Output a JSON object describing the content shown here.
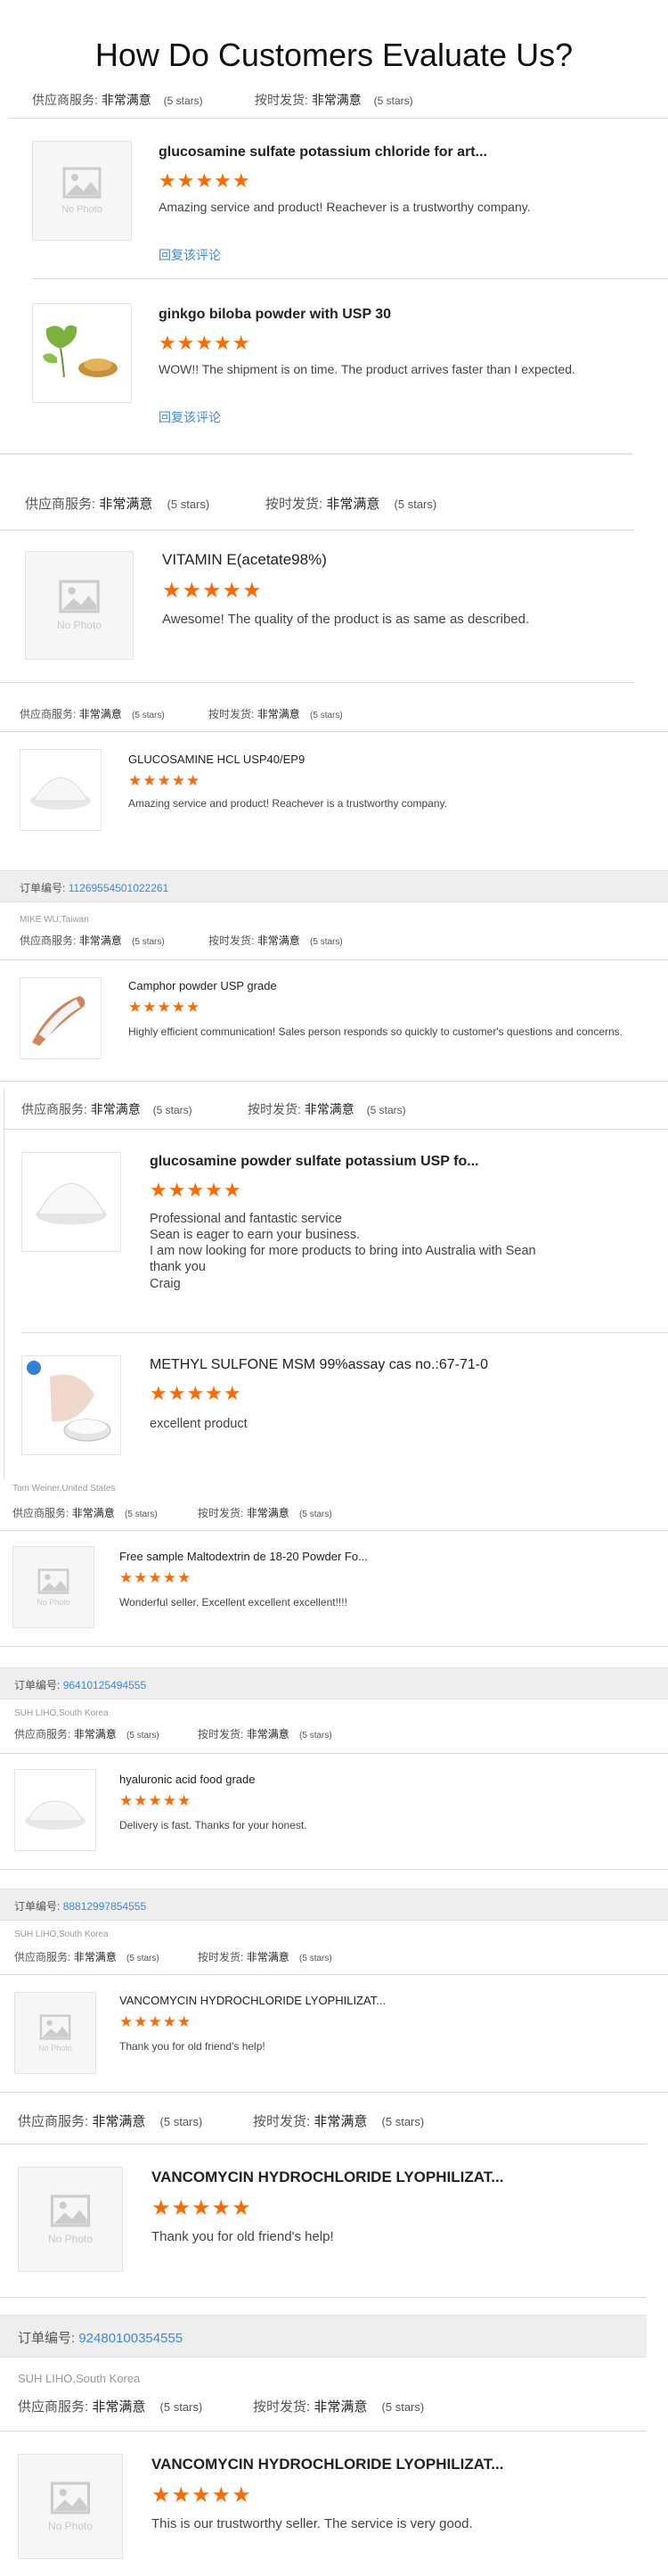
{
  "heading": "How Do Customers Evaluate Us?",
  "meta_labels": {
    "supplier": "供应商服务:",
    "ontime": "按时发货:",
    "value": "非常满意",
    "stars": "(5 stars)"
  },
  "no_photo": "No Photo",
  "reply_label": "回复该评论",
  "star_glyphs": "★★★★★",
  "order_label": "订单编号:",
  "block1": {
    "reviews": [
      {
        "title": "glucosamine sulfate potassium chloride for art...",
        "text": "Amazing service and product! Reachever is a trustworthy company."
      },
      {
        "title": "ginkgo biloba powder with USP 30",
        "text": "WOW!! The shipment is on time. The product arrives faster than I expected."
      }
    ]
  },
  "block2": {
    "title": "VITAMIN E(acetate98%)",
    "text": "Awesome! The quality of the product is as same as described."
  },
  "block3": {
    "title": "GLUCOSAMINE HCL USP40/EP9",
    "text": "Amazing service and product! Reachever is a trustworthy company."
  },
  "block4": {
    "order_no": "112695545010222​61",
    "user": "MIKE WU,Taiwan",
    "title": "Camphor powder USP grade",
    "text": "Highly efficient communication! Sales person responds so quickly to customer's questions and concerns."
  },
  "block5": {
    "reviews": [
      {
        "title": "glucosamine powder sulfate potassium USP fo...",
        "lines": [
          "Professional and fantastic service",
          "Sean is eager to earn your business.",
          "I am now looking for more products to bring into Australia with Sean",
          "thank you",
          "Craig"
        ]
      },
      {
        "title": "METHYL SULFONE MSM 99%assay cas no.:67-71-0",
        "lines": [
          "excellent product"
        ]
      }
    ]
  },
  "block6": {
    "user": "Tom Weiner,United States",
    "title": "Free sample Maltodextrin de 18-20 Powder Fo...",
    "text": "Wonderful seller. Excellent excellent excellent!!!!"
  },
  "block7": {
    "order_no": "96410125494555",
    "user": "SUH LIHO,South Korea",
    "title": "hyaluronic acid food grade",
    "text": "Delivery is fast. Thanks for your honest."
  },
  "block8": {
    "order_no": "88812997854555",
    "user": "SUH LIHO,South Korea",
    "title": "VANCOMYCIN HYDROCHLORIDE LYOPHILIZAT...",
    "text": "Thank you for old friend's help!"
  },
  "block9": {
    "title": "VANCOMYCIN HYDROCHLORIDE LYOPHILIZAT...",
    "text": "Thank you for old friend's help!"
  },
  "block10": {
    "order_no": "92480100354555",
    "user": "SUH LIHO,South Korea",
    "title": "VANCOMYCIN HYDROCHLORIDE LYOPHILIZAT...",
    "text": "This is our trustworthy seller. The service is very good."
  }
}
